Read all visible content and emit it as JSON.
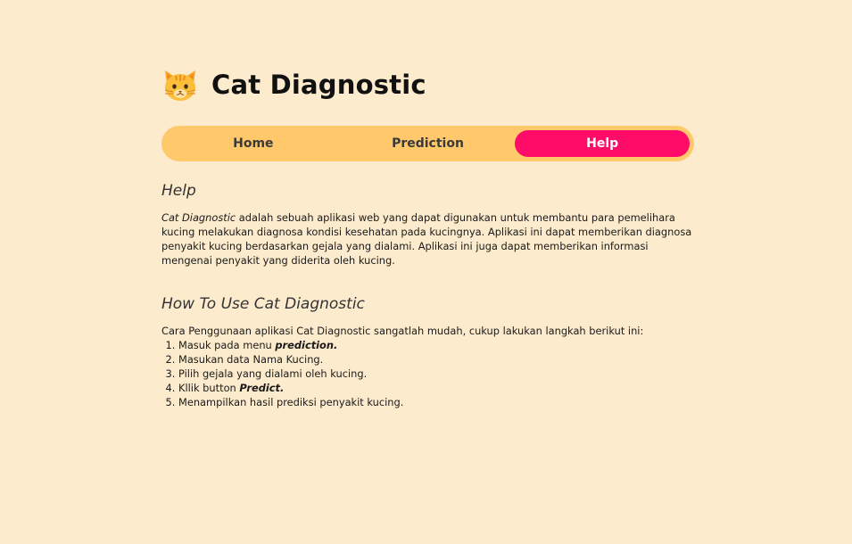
{
  "app": {
    "title": "Cat Diagnostic",
    "logo_icon": "cat-face-icon"
  },
  "nav": {
    "items": [
      {
        "label": "Home",
        "active": false
      },
      {
        "label": "Prediction",
        "active": false
      },
      {
        "label": "Help",
        "active": true
      }
    ],
    "bg_color": "#ffc96b",
    "active_color": "#ff0b68"
  },
  "help": {
    "title": "Help",
    "app_name_italic": "Cat Diagnostic",
    "text": " adalah sebuah aplikasi web yang dapat digunakan untuk membantu para pemelihara kucing melakukan diagnosa kondisi kesehatan pada kucingnya. Aplikasi ini dapat memberikan diagnosa penyakit kucing berdasarkan gejala yang dialami. Aplikasi ini juga dapat memberikan informasi mengenai penyakit yang diderita oleh kucing."
  },
  "howto": {
    "title": "How To Use Cat Diagnostic",
    "intro": "Cara Penggunaan aplikasi Cat Diagnostic sangatlah mudah, cukup lakukan langkah berikut ini:",
    "steps": [
      {
        "text": "Masuk pada menu ",
        "emph": "prediction."
      },
      {
        "text": "Masukan data Nama Kucing.",
        "emph": ""
      },
      {
        "text": "Pilih gejala yang dialami oleh kucing.",
        "emph": ""
      },
      {
        "text": "Kllik button ",
        "emph": "Predict."
      },
      {
        "text": "Menampilkan hasil prediksi penyakit kucing.",
        "emph": ""
      }
    ]
  },
  "colors": {
    "background": "#fdebcd"
  }
}
